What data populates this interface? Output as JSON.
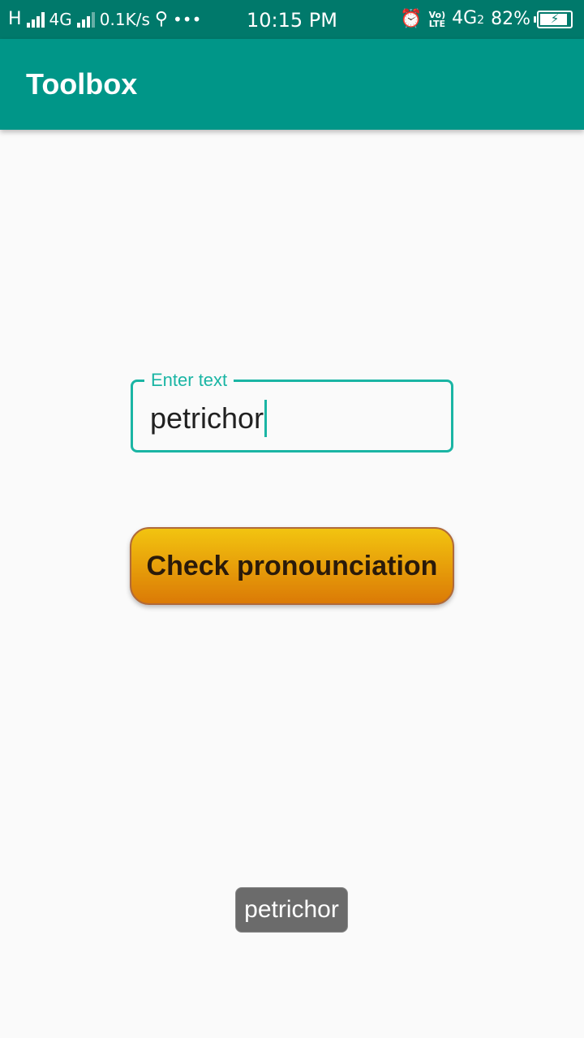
{
  "status_bar": {
    "network_type_1": "H",
    "network_type_2": "4G",
    "speed": "0.1K/s",
    "overflow_dots": "•••",
    "time": "10:15 PM",
    "volte_top": "Vo)",
    "volte_bottom": "LTE",
    "network_type_3": "4G",
    "sim_slot": "2",
    "battery": "82%"
  },
  "app_bar": {
    "title": "Toolbox"
  },
  "text_field": {
    "label": "Enter text",
    "value": "petrichor"
  },
  "check_button": {
    "label": "Check pronounciation"
  },
  "toast": {
    "text": "petrichor"
  },
  "colors": {
    "status_bar": "#00796b",
    "app_bar": "#009688",
    "accent": "#1ab5a4",
    "button_top": "#f2c410",
    "button_bottom": "#db7a06",
    "toast_bg": "#6b6b6b",
    "background": "#fafafa"
  }
}
